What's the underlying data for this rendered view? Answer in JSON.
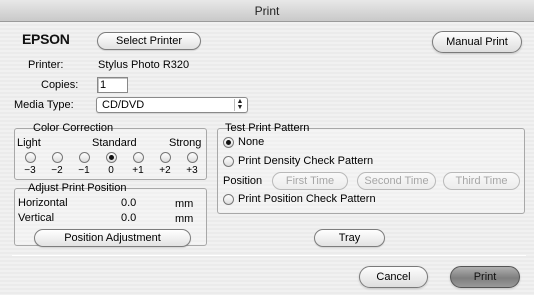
{
  "window": {
    "title": "Print"
  },
  "header": {
    "brand": "EPSON",
    "select_printer_label": "Select Printer",
    "manual_print_label": "Manual Print"
  },
  "settings": {
    "printer_label": "Printer:",
    "printer_value": "Stylus Photo R320",
    "copies_label": "Copies:",
    "copies_value": "1",
    "media_type_label": "Media Type:",
    "media_type_value": "CD/DVD"
  },
  "color_correction": {
    "title": "Color Correction",
    "light_label": "Light",
    "standard_label": "Standard",
    "strong_label": "Strong",
    "ticks": [
      "−3",
      "−2",
      "−1",
      "0",
      "+1",
      "+2",
      "+3"
    ],
    "selected_index": 3
  },
  "adjust_position": {
    "title": "Adjust Print Position",
    "horizontal_label": "Horizontal",
    "horizontal_value": "0.0",
    "horizontal_unit": "mm",
    "vertical_label": "Vertical",
    "vertical_value": "0.0",
    "vertical_unit": "mm",
    "button_label": "Position Adjustment"
  },
  "test_print": {
    "title": "Test Print Pattern",
    "option_none": "None",
    "option_density": "Print Density Check Pattern",
    "position_label": "Position",
    "first_time": "First Time",
    "second_time": "Second Time",
    "third_time": "Third Time",
    "option_position": "Print Position Check Pattern",
    "selected": "None"
  },
  "footer": {
    "tray_label": "Tray",
    "cancel_label": "Cancel",
    "print_label": "Print"
  }
}
